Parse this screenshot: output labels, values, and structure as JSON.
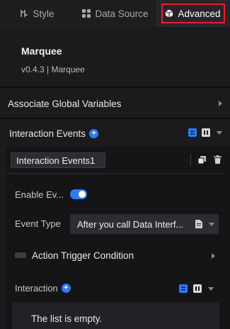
{
  "tabs": {
    "style": "Style",
    "data_source": "Data Source",
    "advanced": "Advanced"
  },
  "component": {
    "title": "Marquee",
    "version": "v0.4.3 | Marquee"
  },
  "global_vars": {
    "label": "Associate Global Variables"
  },
  "interaction_events": {
    "label": "Interaction Events",
    "event_name": "Interaction Events1",
    "enable_label": "Enable Ev...",
    "enabled": true,
    "event_type_label": "Event Type",
    "event_type_value": "After you call Data Interf...",
    "action_trigger_label": "Action Trigger Condition",
    "interaction_label": "Interaction",
    "empty_text": "The list is empty."
  },
  "colors": {
    "accent": "#2f7bf5",
    "highlight_border": "#e3232c",
    "background": "#1b1b1d"
  }
}
